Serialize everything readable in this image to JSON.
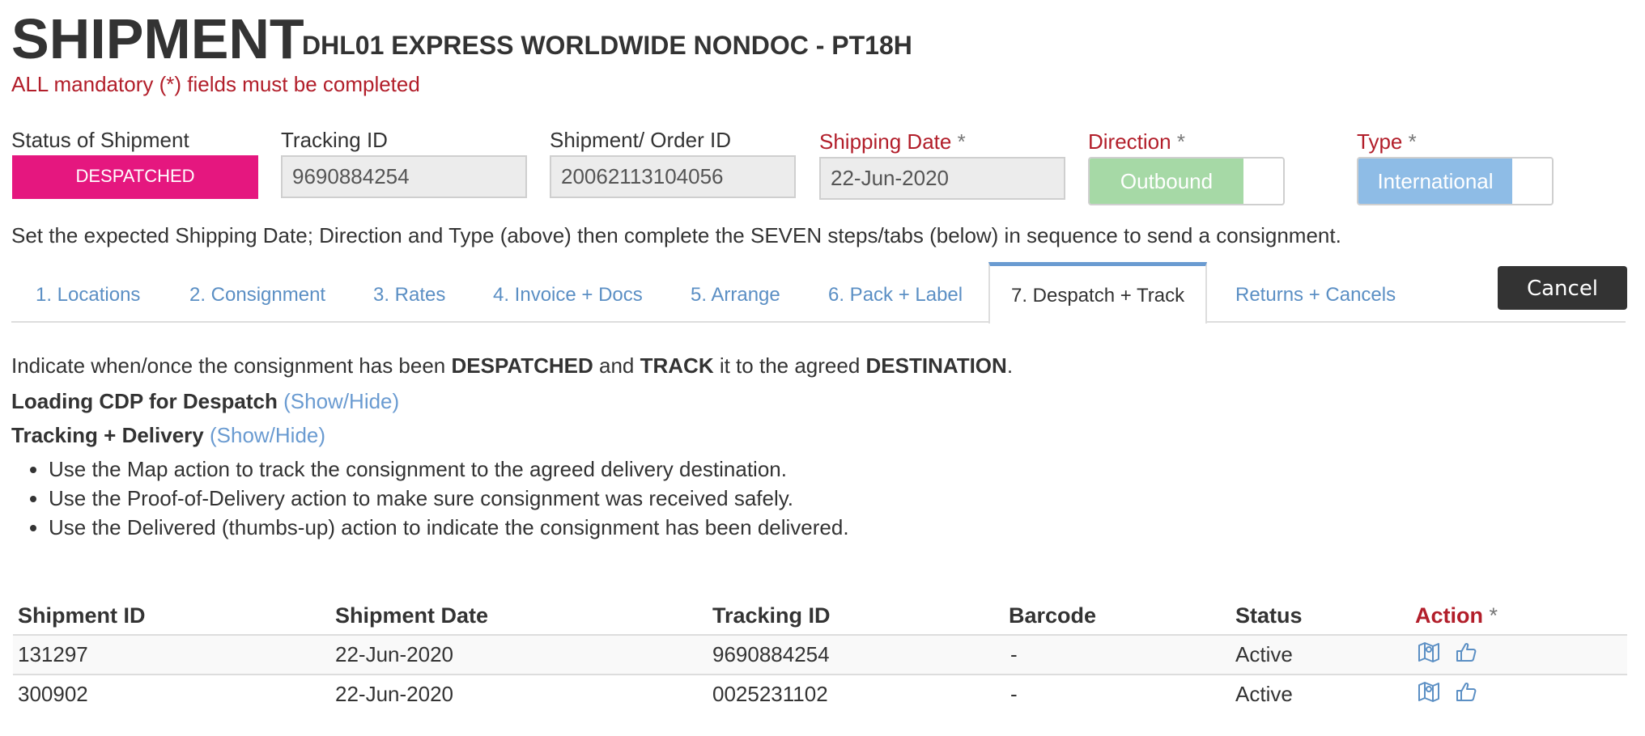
{
  "header": {
    "title": "SHIPMENT",
    "subtitle": "DHL01 EXPRESS WORLDWIDE NONDOC - PT18H",
    "mandatory_note": "ALL mandatory (*) fields must be completed"
  },
  "fields": {
    "status": {
      "label": "Status of Shipment",
      "value": "DESPATCHED"
    },
    "tracking": {
      "label": "Tracking ID",
      "value": "9690884254"
    },
    "order": {
      "label": "Shipment/ Order ID",
      "value": "20062113104056"
    },
    "shipping_date": {
      "label": "Shipping Date",
      "star": "*",
      "value": "22-Jun-2020"
    },
    "direction": {
      "label": "Direction",
      "star": "*",
      "value": "Outbound"
    },
    "type": {
      "label": "Type",
      "star": "*",
      "value": "International"
    }
  },
  "instruction": "Set the expected Shipping Date; Direction and Type (above) then complete the SEVEN steps/tabs (below) in sequence to send a consignment.",
  "tabs": [
    {
      "label": "1. Locations"
    },
    {
      "label": "2. Consignment"
    },
    {
      "label": "3. Rates"
    },
    {
      "label": "4. Invoice + Docs"
    },
    {
      "label": "5. Arrange"
    },
    {
      "label": "6. Pack + Label"
    },
    {
      "label": "7. Despatch + Track"
    },
    {
      "label": "Returns + Cancels"
    }
  ],
  "active_tab": "7. Despatch + Track",
  "cancel_label": "Cancel",
  "intro": {
    "p1": "Indicate when/once the consignment has been ",
    "w1": "DESPATCHED",
    "p2": " and ",
    "w2": "TRACK",
    "p3": " it to the agreed ",
    "w3": "DESTINATION",
    "p4": "."
  },
  "sections": {
    "loading": {
      "title": "Loading CDP for Despatch",
      "toggle": "(Show/Hide)"
    },
    "tracking": {
      "title": "Tracking + Delivery",
      "toggle": "(Show/Hide)"
    }
  },
  "bullets": [
    "Use the Map action to track the consignment to the agreed delivery destination.",
    "Use the Proof-of-Delivery action to make sure consignment was received safely.",
    "Use the Delivered (thumbs-up) action to indicate the consignment has been delivered."
  ],
  "table": {
    "headers": {
      "shipment_id": "Shipment ID",
      "shipment_date": "Shipment Date",
      "tracking_id": "Tracking ID",
      "barcode": "Barcode",
      "status": "Status",
      "action": "Action",
      "action_star": "*"
    },
    "rows": [
      {
        "shipment_id": "131297",
        "shipment_date": "22-Jun-2020",
        "tracking_id": "9690884254",
        "barcode": "-",
        "status": "Active",
        "actions": [
          "map-icon",
          "thumbs-up-icon"
        ]
      },
      {
        "shipment_id": "300902",
        "shipment_date": "22-Jun-2020",
        "tracking_id": "0025231102",
        "barcode": "-",
        "status": "Active",
        "actions": [
          "map-icon",
          "thumbs-up-icon"
        ]
      }
    ]
  },
  "colors": {
    "required_red": "#b21e2a",
    "status_pink": "#e5177f",
    "outbound_green": "#a6d9a6",
    "international_blue": "#8ebce6",
    "link_blue": "#6a9bd1",
    "cancel_dark": "#333333"
  }
}
